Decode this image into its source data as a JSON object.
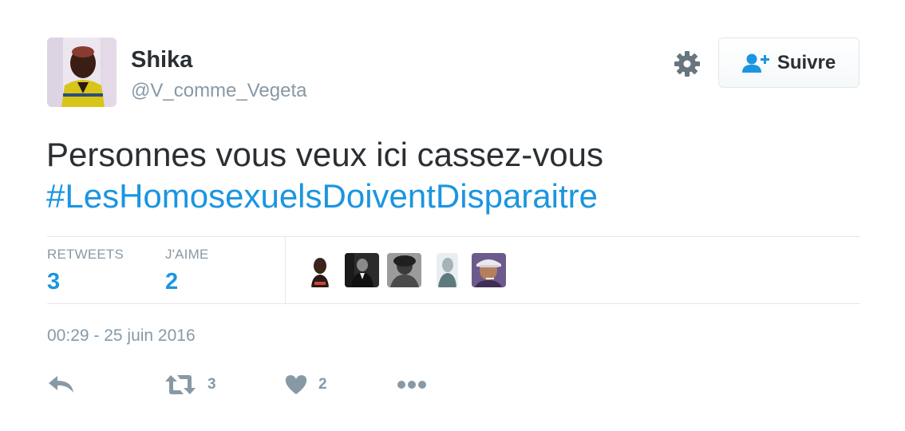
{
  "user": {
    "display_name": "Shika",
    "screen_name": "@V_comme_Vegeta",
    "avatar_icon": "profile-photo"
  },
  "header": {
    "settings_icon": "gear-icon",
    "follow_label": "Suivre",
    "follow_icon": "user-plus-icon"
  },
  "tweet": {
    "text": "Personnes vous veux ici cassez-vous",
    "hashtag": "#LesHomosexuelsDoiventDisparaitre"
  },
  "stats": {
    "retweets_label": "RETWEETS",
    "retweets_value": "3",
    "likes_label": "J'AIME",
    "likes_value": "2"
  },
  "timestamp": "00:29 - 25 juin 2016",
  "actions": {
    "reply_icon": "reply-icon",
    "retweet_icon": "retweet-icon",
    "retweet_count": "3",
    "like_icon": "heart-icon",
    "like_count": "2",
    "more_icon": "more-icon"
  },
  "colors": {
    "accent": "#1b95e0",
    "text": "#292f33",
    "muted": "#8899a6",
    "border": "#e1e8ed"
  }
}
